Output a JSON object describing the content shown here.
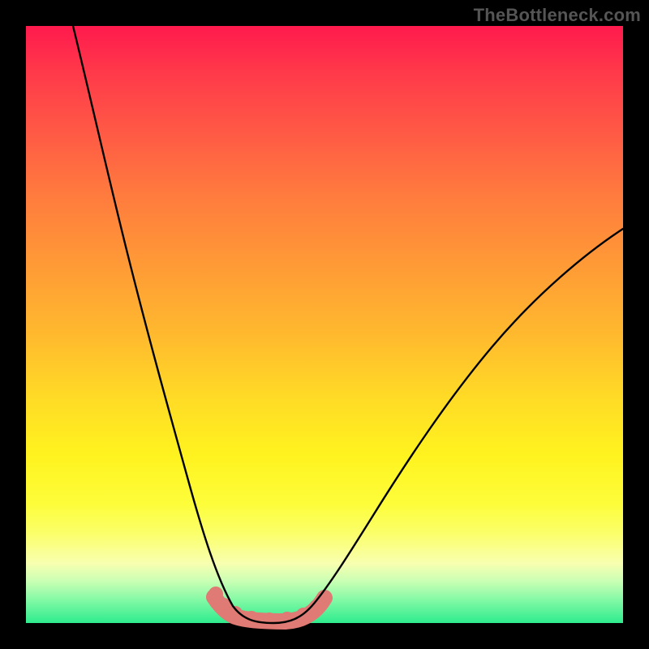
{
  "watermark": "TheBottleneck.com",
  "chart_data": {
    "type": "line",
    "title": "",
    "xlabel": "",
    "ylabel": "",
    "xlim": [
      0,
      100
    ],
    "ylim": [
      0,
      100
    ],
    "grid": false,
    "legend": false,
    "background": "rainbow-gradient",
    "series": [
      {
        "name": "bottleneck-curve",
        "color": "#000000",
        "x": [
          0,
          5,
          10,
          15,
          20,
          25,
          30,
          32,
          35,
          38,
          40,
          45,
          50,
          55,
          60,
          70,
          80,
          90,
          100
        ],
        "values": [
          100,
          85,
          68,
          52,
          37,
          23,
          11,
          6,
          2,
          0,
          0,
          0,
          3,
          8,
          14,
          28,
          42,
          54,
          65
        ]
      },
      {
        "name": "flat-highlight",
        "color": "#e07a74",
        "type": "scatter",
        "x": [
          32,
          34,
          36,
          38,
          40,
          42,
          44,
          46,
          48
        ],
        "values": [
          5,
          2,
          1,
          0,
          0,
          0,
          1,
          2,
          4
        ]
      }
    ],
    "annotations": []
  }
}
